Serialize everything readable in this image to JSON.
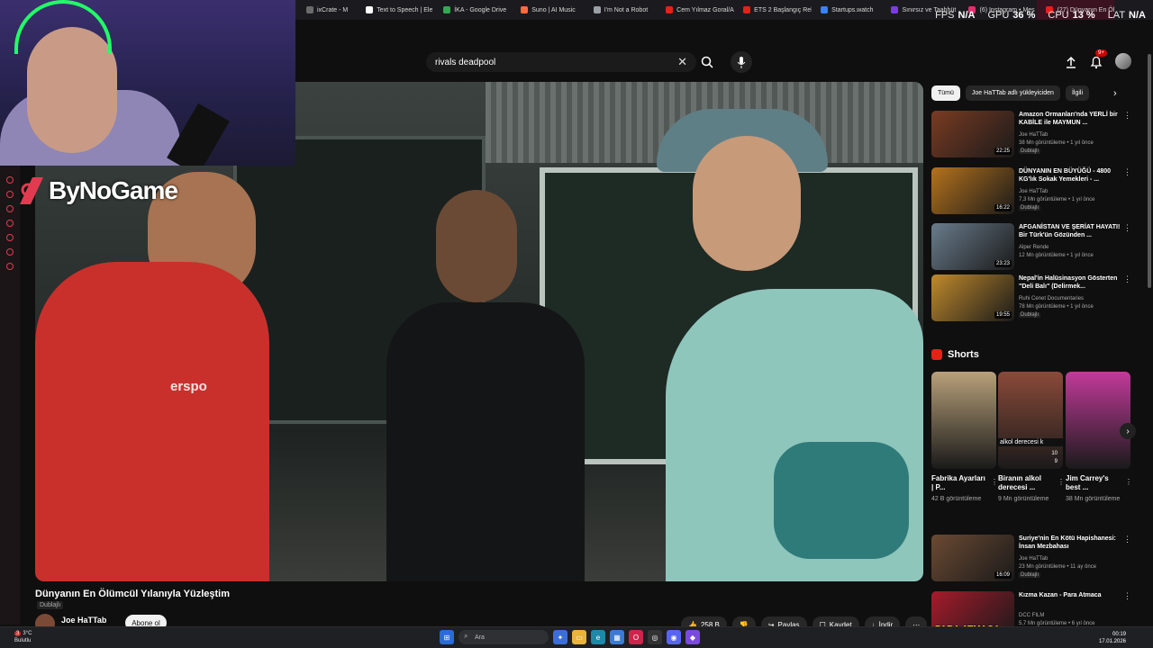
{
  "browser": {
    "tabs": [
      {
        "label": "ixCrate - M",
        "color": "#6b6b6b"
      },
      {
        "label": "Text to Speech | Ele",
        "color": "#ffffff"
      },
      {
        "label": "İKA - Google Drive",
        "color": "#34a853"
      },
      {
        "label": "Suno | AI Music",
        "color": "#ff6b3d"
      },
      {
        "label": "I'm Not a Robot",
        "color": "#9aa0a6"
      },
      {
        "label": "Cem Yılmaz Goral/Ar",
        "color": "#e62117"
      },
      {
        "label": "ETS 2 Başlangıç Reh",
        "color": "#e62117"
      },
      {
        "label": "Startups.watch",
        "color": "#3b82f6"
      },
      {
        "label": "Sınırsız ve Taahhüt",
        "color": "#7c3aed"
      },
      {
        "label": "(6) Instagram • Mes",
        "color": "#e1306c"
      },
      {
        "label": "(27) Dünyanın En Ölüm",
        "color": "#e62117",
        "active": true
      }
    ]
  },
  "perf": {
    "fps_label": "FPS",
    "fps_value": "N/A",
    "gpu_label": "GPU",
    "gpu_value": "36 %",
    "cpu_label": "CPU",
    "cpu_value": "13 %",
    "lat_label": "LAT",
    "lat_value": "N/A"
  },
  "youtube": {
    "search_value": "rivals deadpool",
    "notification_badge": "9+"
  },
  "overlay": {
    "logo_text": "ByNoGame"
  },
  "video": {
    "shirt_text": "erspo",
    "title": "Dünyanın En Ölümcül Yılanıyla Yüzleştim",
    "dubbed_label": "Dublajlı",
    "channel_name": "Joe HaTTab",
    "subscribe_label": "Abone ol",
    "like_count": "258 B",
    "share_label": "Paylaş",
    "save_label": "Kaydet",
    "download_label": "İndir"
  },
  "chips": [
    {
      "label": "Tümü",
      "selected": true
    },
    {
      "label": "Joe HaTTab adlı yükleyiciden",
      "selected": false
    },
    {
      "label": "İlgili",
      "selected": false
    }
  ],
  "recommendations": [
    {
      "title": "Amazon Ormanları'nda YERLİ bir KABİLE ile MAYMUN ...",
      "channel": "Joe HaTTab",
      "meta": "38 Mn görüntüleme • 1 yıl önce",
      "duration": "22:25",
      "dubbed": "Dublajlı",
      "thumb": "#7a3b22"
    },
    {
      "title": "DÜNYANIN EN BÜYÜĞÜ - 4800 KG'lık Sokak Yemekleri - ...",
      "channel": "Joe HaTTab",
      "meta": "7,3 Mn görüntüleme • 1 yıl önce",
      "duration": "16:22",
      "dubbed": "Dublajlı",
      "thumb": "#b5721c"
    },
    {
      "title": "AFGANİSTAN VE ŞERİAT HAYATI! Bir Türk'ün Gözünden ...",
      "channel": "Alper Rende",
      "meta": "12 Mn görüntüleme • 1 yıl önce",
      "duration": "23:23",
      "dubbed": "",
      "thumb": "#6a7c8c"
    },
    {
      "title": "Nepal'in Halüsinasyon Gösterten \"Deli Balı\" (Delirmek...",
      "channel": "Ruhi Cenet Documentaries",
      "meta": "78 Mn görüntüleme • 1 yıl önce",
      "duration": "19:55",
      "dubbed": "Dublajlı",
      "thumb": "#c08a2c"
    },
    {
      "title": "Suriye'nin En Kötü Hapishanesi: İnsan Mezbahası",
      "channel": "Joe HaTTab",
      "meta": "23 Mn görüntüleme • 11 ay önce",
      "duration": "16:09",
      "dubbed": "Dublajlı",
      "thumb": "#6b4a32"
    },
    {
      "title": "Kızma Kazan - Para Atmaca",
      "channel": "DCC FILM",
      "meta": "5,7 Mn görüntüleme • 6 yıl önce",
      "duration": "",
      "dubbed": "",
      "thumb": "#a61b2b",
      "thumb_text": "PARA ATMACA"
    }
  ],
  "shorts": {
    "heading": "Shorts",
    "items": [
      {
        "title": "Fabrika Ayarları | P...",
        "views": "42 B görüntüleme",
        "thumb": "#b8a07a",
        "overlay": ""
      },
      {
        "title": "Biranın alkol derecesi ...",
        "views": "9 Mn görüntüleme",
        "thumb": "#8a4a3a",
        "overlay": "alkol derecesi k",
        "score_a": "10",
        "score_b": "9"
      },
      {
        "title": "Jim Carrey's best ...",
        "views": "38 Mn görüntüleme",
        "thumb": "#c23a9a",
        "overlay": ""
      }
    ]
  },
  "taskbar": {
    "weather_temp": "3°C",
    "weather_desc": "Bulutlu",
    "weather_badge": "3",
    "search_placeholder": "Ara",
    "time": "00:19",
    "date": "17.01.2026"
  }
}
